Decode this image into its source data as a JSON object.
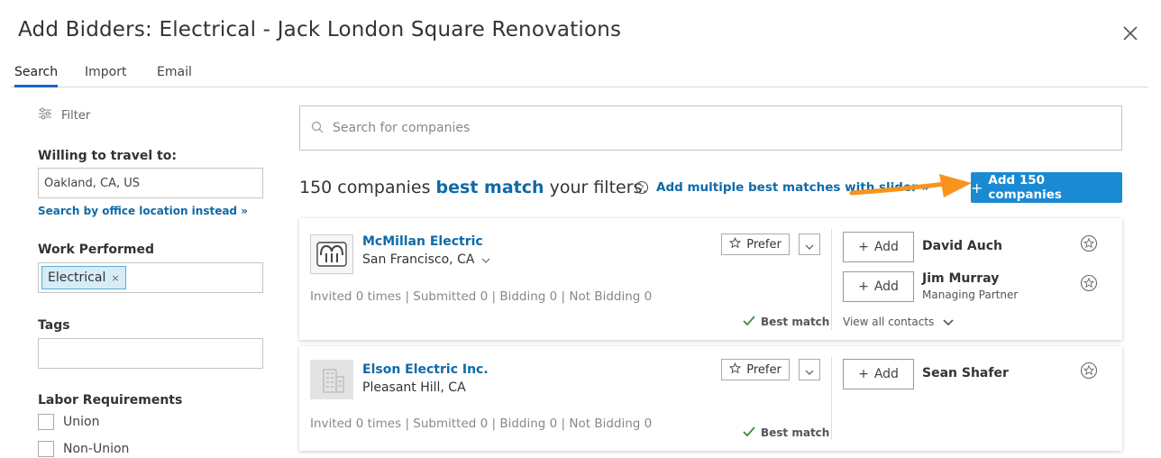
{
  "header": {
    "title": "Add Bidders: Electrical - Jack London Square Renovations"
  },
  "tabs": [
    {
      "label": "Search"
    },
    {
      "label": "Import"
    },
    {
      "label": "Email"
    }
  ],
  "filters": {
    "filter_label": "Filter",
    "travel_label": "Willing to travel to:",
    "travel_value": "Oakland, CA, US",
    "office_link": "Search by office location instead »",
    "work_label": "Work Performed",
    "work_chip": "Electrical",
    "work_chip_remove": "×",
    "tags_label": "Tags",
    "tags_value": "",
    "labor_label": "Labor Requirements",
    "labor_options": [
      {
        "label": "Union"
      },
      {
        "label": "Non-Union"
      }
    ]
  },
  "search": {
    "placeholder": "Search for companies"
  },
  "summary": {
    "prefix": "150 companies",
    "highlight": "best match",
    "suffix": "your filters.",
    "multi_link": "Add multiple best matches with slider »",
    "add_all_label": "Add 150 companies",
    "add_all_plus": "+"
  },
  "colors": {
    "accent": "#1a8ad2",
    "link": "#0f6aa9",
    "arrow": "#f7941d",
    "check": "#3a8a3a"
  },
  "companies": [
    {
      "name": "McMillan Electric",
      "location": "San Francisco, CA",
      "stats": "Invited 0 times | Submitted 0 | Bidding 0 | Not Bidding 0",
      "prefer_label": "Prefer",
      "best_match_label": "Best match",
      "add_label": "Add",
      "contacts": [
        {
          "name": "David Auch",
          "title": ""
        },
        {
          "name": "Jim Murray",
          "title": "Managing Partner"
        }
      ],
      "view_all": "View all contacts"
    },
    {
      "name": "Elson Electric Inc.",
      "location": "Pleasant Hill, CA",
      "stats": "Invited 0 times | Submitted 0 | Bidding 0 | Not Bidding 0",
      "prefer_label": "Prefer",
      "best_match_label": "Best match",
      "add_label": "Add",
      "contacts": [
        {
          "name": "Sean Shafer",
          "title": ""
        }
      ]
    }
  ]
}
